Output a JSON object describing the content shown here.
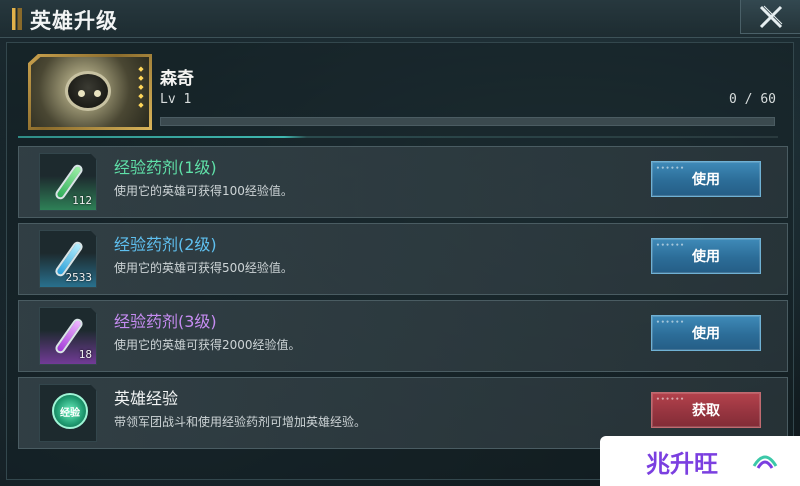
{
  "header": {
    "title": "英雄升级",
    "close_icon": "close-icon"
  },
  "hero": {
    "name": "森奇",
    "level": "Lv 1",
    "exp_text": "0 / 60",
    "exp_progress": 0,
    "stars": 5
  },
  "items": [
    {
      "title": "经验药剂(1级)",
      "description": "使用它的英雄可获得100经验值。",
      "count": "112",
      "button_label": "使用",
      "title_color": "#5fe0a8",
      "icon": "green-potion-icon"
    },
    {
      "title": "经验药剂(2级)",
      "description": "使用它的英雄可获得500经验值。",
      "count": "2533",
      "button_label": "使用",
      "title_color": "#5fc0f0",
      "icon": "blue-potion-icon"
    },
    {
      "title": "经验药剂(3级)",
      "description": "使用它的英雄可获得2000经验值。",
      "count": "18",
      "button_label": "使用",
      "title_color": "#c68cf2",
      "icon": "purple-potion-icon"
    },
    {
      "title": "英雄经验",
      "description": "带领军团战斗和使用经验药剂可增加英雄经验。",
      "emblem_text": "经验",
      "button_label": "获取",
      "title_color": "#f2f4f4",
      "icon": "hero-exp-emblem-icon"
    }
  ],
  "watermark": {
    "text": "兆升旺"
  }
}
